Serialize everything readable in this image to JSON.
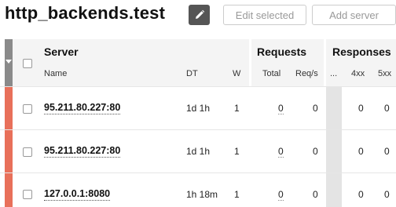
{
  "header": {
    "title": "http_backends.test",
    "edit_icon": "pencil-icon",
    "edit_selected_label": "Edit selected",
    "add_server_label": "Add server"
  },
  "table": {
    "groups": {
      "server": "Server",
      "requests": "Requests",
      "responses": "Responses"
    },
    "columns": {
      "name": "Name",
      "dt": "DT",
      "w": "W",
      "total": "Total",
      "reqs": "Req/s",
      "ellipsis": "...",
      "c4xx": "4xx",
      "c5xx": "5xx"
    },
    "rows": [
      {
        "name": "95.211.80.227:80",
        "dt": "1d 1h",
        "w": "1",
        "total": "0",
        "reqs": "0",
        "c4xx": "0",
        "c5xx": "0"
      },
      {
        "name": "95.211.80.227:80",
        "dt": "1d 1h",
        "w": "1",
        "total": "0",
        "reqs": "0",
        "c4xx": "0",
        "c5xx": "0"
      },
      {
        "name": "127.0.0.1:8080",
        "dt": "1h 18m",
        "w": "1",
        "total": "0",
        "reqs": "0",
        "c4xx": "0",
        "c5xx": "0"
      }
    ]
  },
  "colors": {
    "status_down": "#e8705a",
    "header_bg": "#f4f4f4"
  }
}
